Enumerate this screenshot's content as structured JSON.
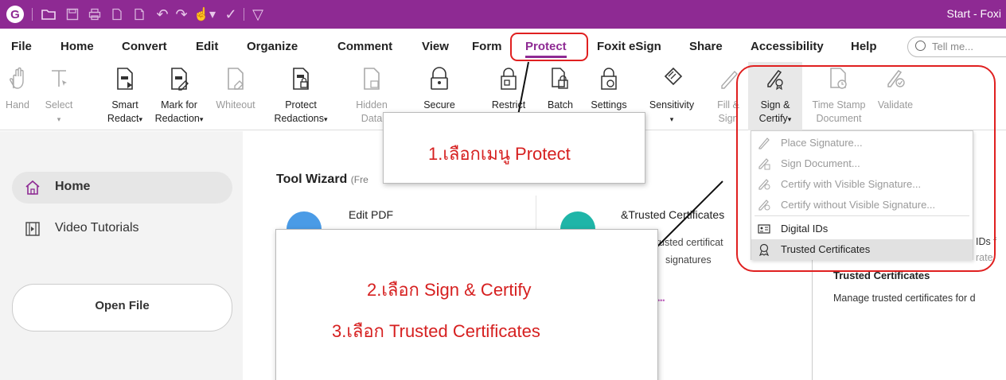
{
  "window": {
    "title": "Start - Foxi"
  },
  "menu": {
    "items": [
      "File",
      "Home",
      "Convert",
      "Edit",
      "Organize",
      "Comment",
      "View",
      "Form",
      "Protect",
      "Foxit eSign",
      "Share",
      "Accessibility",
      "Help"
    ],
    "active": "Protect",
    "search_placeholder": "Tell me..."
  },
  "ribbon": {
    "hand": "Hand",
    "select": "Select",
    "smart_redact": [
      "Smart",
      "Redact"
    ],
    "mark_redaction": [
      "Mark for",
      "Redaction"
    ],
    "whiteout": "Whiteout",
    "protect_redactions": [
      "Protect",
      "Redactions"
    ],
    "hidden_data": [
      "Hidden",
      "Data"
    ],
    "secure": "Secure",
    "restrict": "Restrict",
    "batch": "Batch",
    "settings": "Settings",
    "sensitivity": "Sensitivity",
    "fill_sign": [
      "Fill &",
      "Sign"
    ],
    "sign_certify": [
      "Sign &",
      "Certify"
    ],
    "timestamp": [
      "Time Stamp",
      "Document"
    ],
    "validate": "Validate",
    "caret": "▾"
  },
  "dropdown": {
    "items": [
      {
        "label": "Place Signature...",
        "enabled": false
      },
      {
        "label": "Sign Document...",
        "enabled": false
      },
      {
        "label": "Certify with Visible Signature...",
        "enabled": false
      },
      {
        "label": "Certify without Visible Signature...",
        "enabled": false
      },
      {
        "label": "Digital IDs",
        "enabled": true
      },
      {
        "label": "Trusted Certificates",
        "enabled": true,
        "highlighted": true
      }
    ]
  },
  "sidebar": {
    "home": "Home",
    "video": "Video Tutorials",
    "open_file": "Open File"
  },
  "main": {
    "tool_wizard": "Tool Wizard",
    "tool_wizard_suffix": "(Fre",
    "edit_pdf": "Edit PDF",
    "cert_title": "&Trusted Certificates",
    "cert_desc_1": "e trusted certificat",
    "cert_desc_2": "signatures",
    "dots": "•••"
  },
  "tooltip": {
    "title": "Trusted Certificates",
    "desc": "Manage trusted certificates for d",
    "frag1": "IDs f",
    "frag2": "rate"
  },
  "annotations": {
    "step1": "1.เลือกเมนู Protect",
    "step2": "2.เลือก Sign & Certify",
    "step3": "3.เลือก Trusted Certificates",
    "color": "#d62020"
  },
  "colors": {
    "accent": "#8e2a93",
    "highlight_box": "#e02020"
  }
}
